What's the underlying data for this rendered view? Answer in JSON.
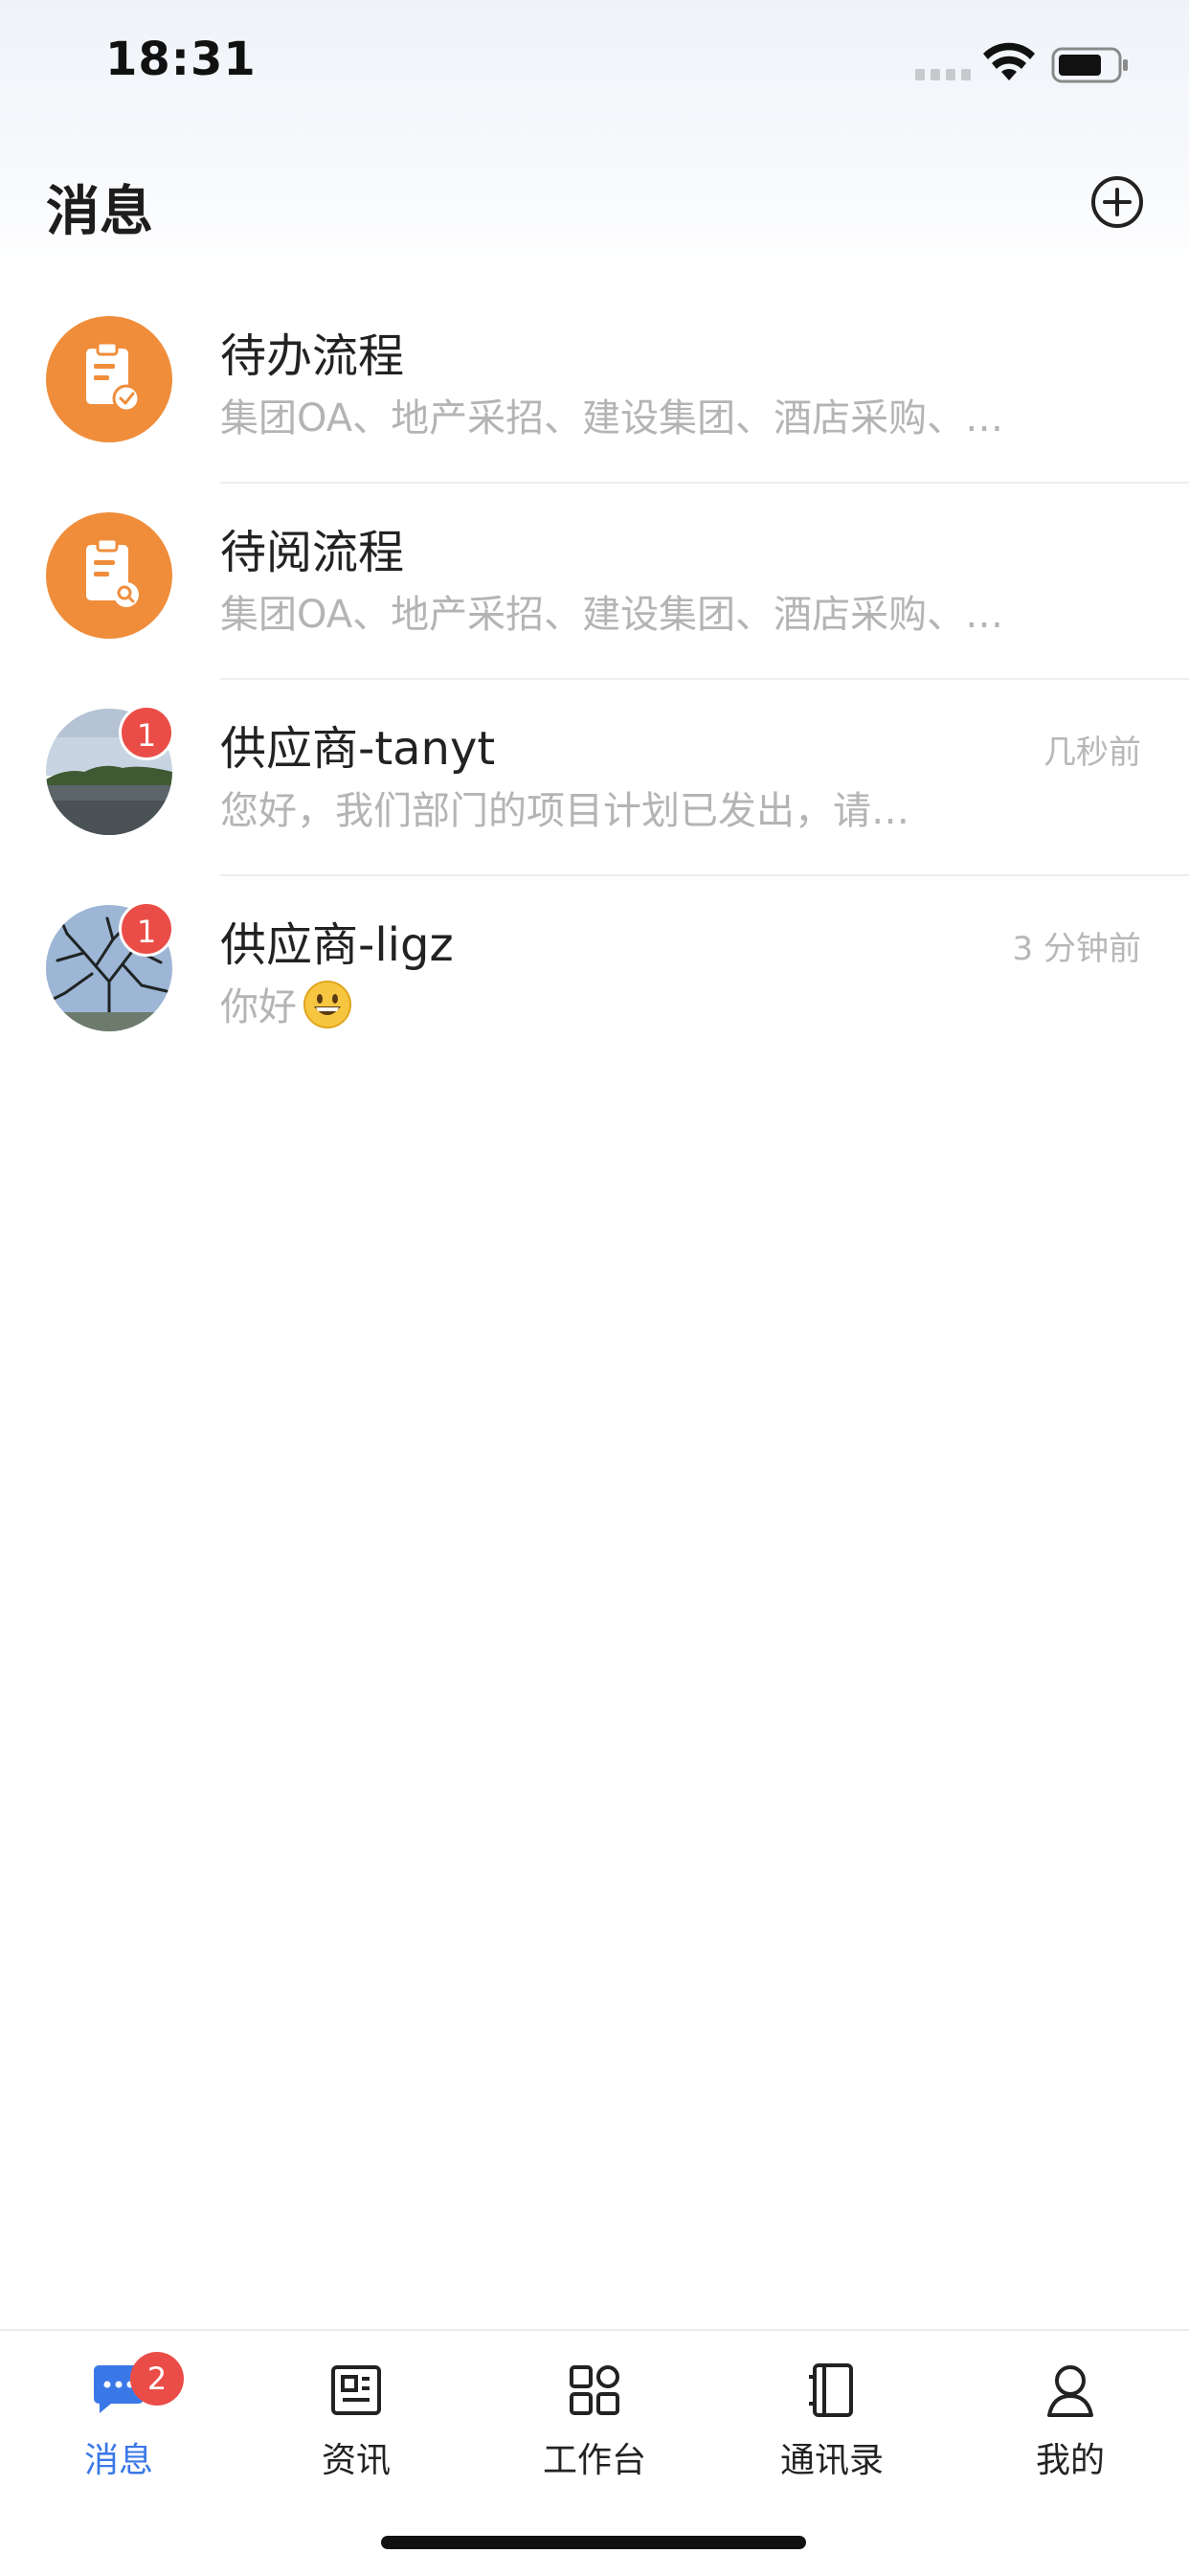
{
  "status_bar": {
    "time": "18:31"
  },
  "header": {
    "title": "消息"
  },
  "messages": [
    {
      "title": "待办流程",
      "subtitle": "集团OA、地产采招、建设集团、酒店采购、…",
      "time": "",
      "badge": ""
    },
    {
      "title": "待阅流程",
      "subtitle": "集团OA、地产采招、建设集团、酒店采购、…",
      "time": "",
      "badge": ""
    },
    {
      "title": "供应商-tanyt",
      "subtitle": "您好，我们部门的项目计划已发出，请…",
      "time": "几秒前",
      "badge": "1"
    },
    {
      "title": "供应商-ligz",
      "subtitle": "你好",
      "time": "3 分钟前",
      "badge": "1"
    }
  ],
  "tabs": [
    {
      "label": "消息",
      "badge": "2",
      "icon": "chat-icon",
      "active": true
    },
    {
      "label": "资讯",
      "icon": "news-icon"
    },
    {
      "label": "工作台",
      "icon": "grid-icon"
    },
    {
      "label": "通讯录",
      "icon": "contacts-icon"
    },
    {
      "label": "我的",
      "icon": "profile-icon"
    }
  ],
  "colors": {
    "accent": "#3b78e7",
    "badge": "#ea4d47",
    "avatar_orange": "#ef8d3b"
  }
}
